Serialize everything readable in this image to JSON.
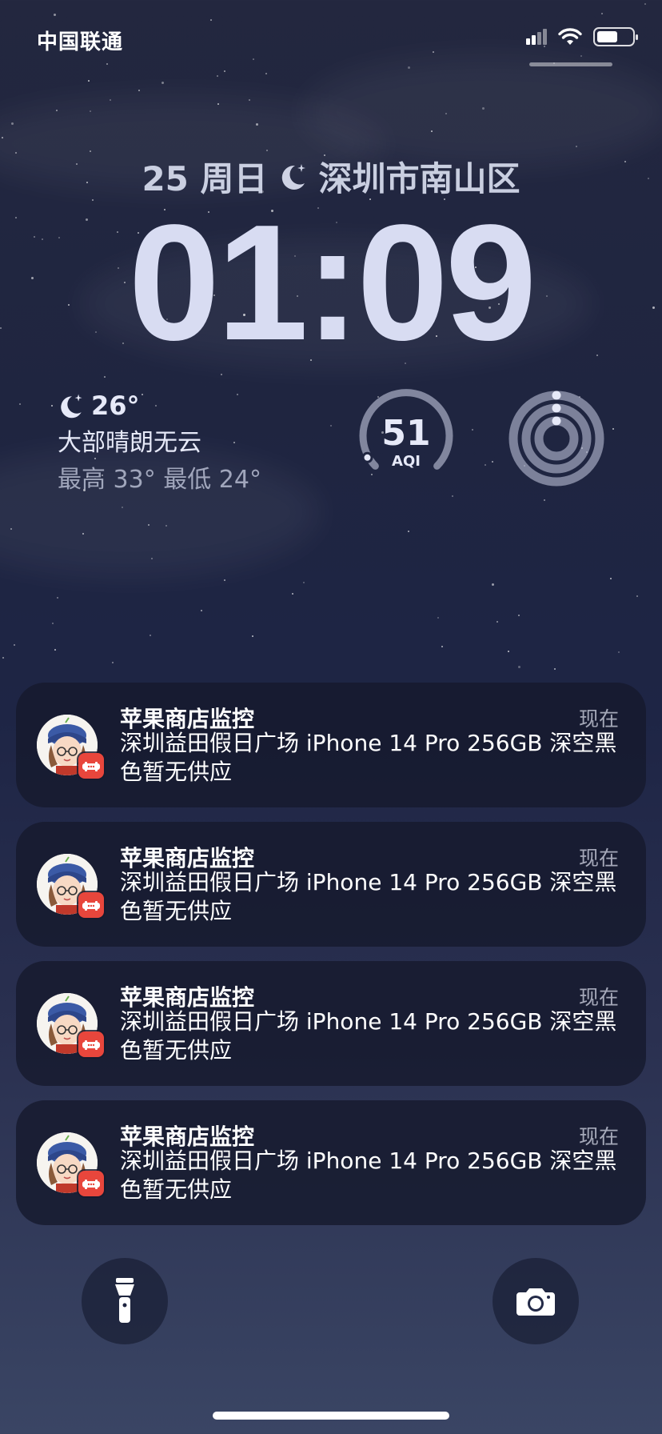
{
  "status_bar": {
    "carrier": "中国联通",
    "signal_icon": "signal-bars-icon",
    "wifi_icon": "wifi-icon",
    "battery_icon": "battery-icon",
    "battery_level": 0.6
  },
  "lock_screen": {
    "date": "25 周日",
    "location": "深圳市南山区",
    "time": "01:09"
  },
  "widgets": {
    "weather": {
      "icon": "moon-stars-icon",
      "temp": "26°",
      "description": "大部晴朗无云",
      "range": "最高 33° 最低 24°"
    },
    "aqi": {
      "value": "51",
      "label": "AQI",
      "level": 0.25
    },
    "activity": {
      "icon": "activity-rings-icon"
    }
  },
  "notifications": [
    {
      "app": "苹果商店监控",
      "time": "现在",
      "body": "深圳益田假日广场 iPhone 14 Pro 256GB 深空黑色暂无供应"
    },
    {
      "app": "苹果商店监控",
      "time": "现在",
      "body": "深圳益田假日广场 iPhone 14 Pro 256GB 深空黑色暂无供应"
    },
    {
      "app": "苹果商店监控",
      "time": "现在",
      "body": "深圳益田假日广场 iPhone 14 Pro 256GB 深空黑色暂无供应"
    },
    {
      "app": "苹果商店监控",
      "time": "现在",
      "body": "深圳益田假日广场 iPhone 14 Pro 256GB 深空黑色暂无供应"
    }
  ],
  "bottom": {
    "flashlight_icon": "flashlight-icon",
    "camera_icon": "camera-icon"
  },
  "colors": {
    "notification_bg": "#161a2d",
    "badge": "#e8463c",
    "clock": "#d8dcf2"
  }
}
